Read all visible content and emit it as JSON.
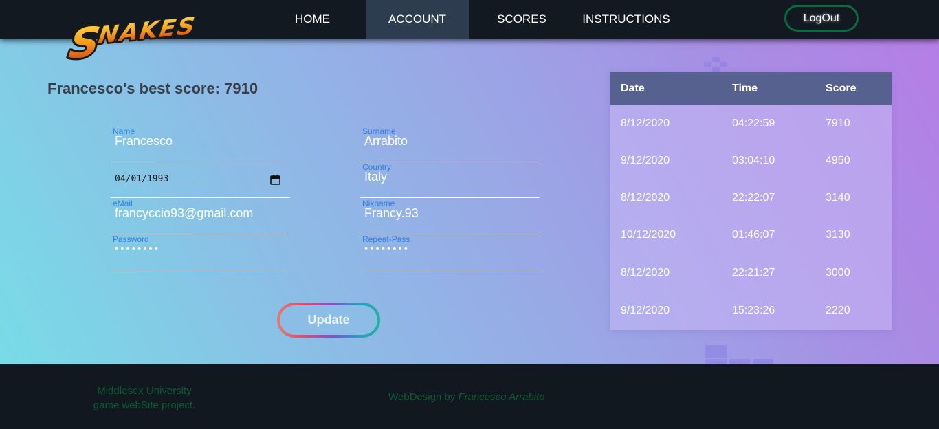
{
  "logo": {
    "text": "SNAKES"
  },
  "nav": {
    "links": [
      {
        "label": "HOME"
      },
      {
        "label": "ACCOUNT"
      },
      {
        "label": "SCORES"
      },
      {
        "label": "INSTRUCTIONS"
      }
    ],
    "active": "ACCOUNT",
    "logout_label": "LogOut"
  },
  "account": {
    "best_score_text": "Francesco's best score: 7910",
    "fields": {
      "name": {
        "label": "Name",
        "value": "Francesco"
      },
      "surname": {
        "label": "Surname",
        "value": "Arrabito"
      },
      "birthdate": {
        "value": "04/01/1993"
      },
      "country": {
        "label": "Country",
        "value": "Italy"
      },
      "email": {
        "label": "eMail",
        "value": "francyccio93@gmail.com"
      },
      "nickname": {
        "label": "Nikname",
        "value": "Francy.93"
      },
      "password": {
        "label": "Password",
        "value": "••••••••"
      },
      "repeat_pass": {
        "label": "Repeat-Pass",
        "value": "••••••••"
      }
    },
    "update_label": "Update"
  },
  "scores_table": {
    "headers": [
      "Date",
      "Time",
      "Score"
    ],
    "rows": [
      [
        "8/12/2020",
        "04:22:59",
        "7910"
      ],
      [
        "9/12/2020",
        "03:04:10",
        "4950"
      ],
      [
        "8/12/2020",
        "22:22:07",
        "3140"
      ],
      [
        "10/12/2020",
        "01:46:07",
        "3130"
      ],
      [
        "8/12/2020",
        "22:21:27",
        "3000"
      ],
      [
        "9/12/2020",
        "15:23:26",
        "2220"
      ]
    ]
  },
  "footer": {
    "line1": "Middlesex University",
    "line2": "game webSite project.",
    "credit_prefix": "WebDesign by",
    "credit_name": "Francesco Arrabito"
  },
  "colors": {
    "nav_bg": "#121920",
    "nav_active": "#2e3c50",
    "logout_border": "#0b6b3c",
    "table_header": "#56618f",
    "field_label": "#2f7fe0",
    "footer_text": "#0f5a2f"
  }
}
